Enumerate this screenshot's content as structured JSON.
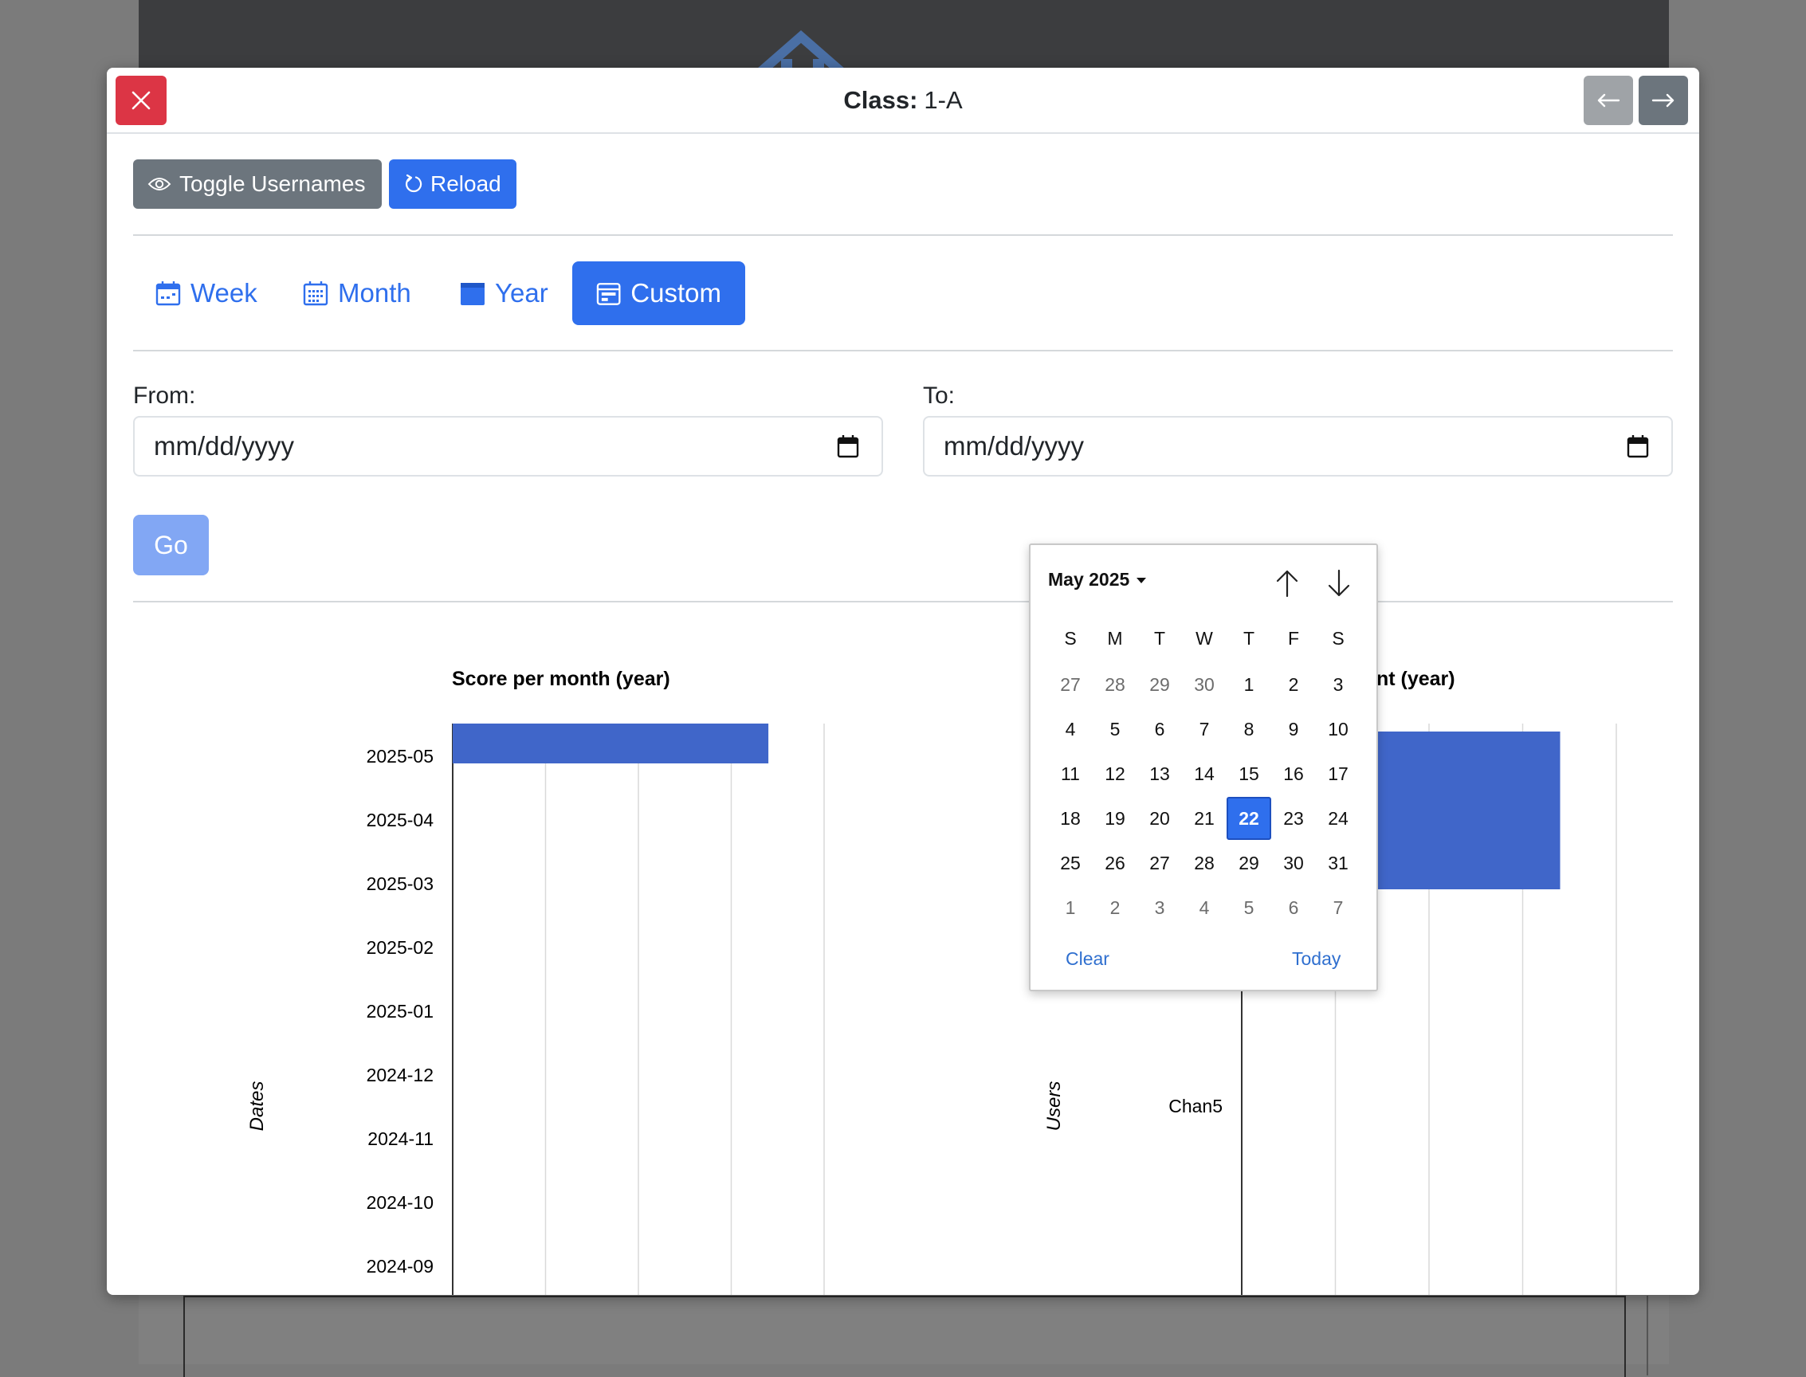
{
  "modal": {
    "title_label": "Class:",
    "title_value": "1-A"
  },
  "toolbar": {
    "toggle_usernames": "Toggle Usernames",
    "reload": "Reload"
  },
  "periods": {
    "week": "Week",
    "month": "Month",
    "year": "Year",
    "custom": "Custom",
    "active": "custom"
  },
  "form": {
    "from_label": "From:",
    "to_label": "To:",
    "from_value": "mm/dd/yyyy",
    "to_value": "mm/dd/yyyy",
    "go": "Go"
  },
  "datepicker": {
    "month_label": "May 2025",
    "weekdays": [
      "S",
      "M",
      "T",
      "W",
      "T",
      "F",
      "S"
    ],
    "weeks": [
      [
        "27",
        "28",
        "29",
        "30",
        "1",
        "2",
        "3"
      ],
      [
        "4",
        "5",
        "6",
        "7",
        "8",
        "9",
        "10"
      ],
      [
        "11",
        "12",
        "13",
        "14",
        "15",
        "16",
        "17"
      ],
      [
        "18",
        "19",
        "20",
        "21",
        "22",
        "23",
        "24"
      ],
      [
        "25",
        "26",
        "27",
        "28",
        "29",
        "30",
        "31"
      ],
      [
        "1",
        "2",
        "3",
        "4",
        "5",
        "6",
        "7"
      ]
    ],
    "selected_day": "22",
    "clear": "Clear",
    "today": "Today"
  },
  "chart_data": [
    {
      "type": "bar",
      "orientation": "horizontal",
      "title": "Score per month (year)",
      "ylabel": "Dates",
      "categories": [
        "2025-05",
        "2025-04",
        "2025-03",
        "2025-02",
        "2025-01",
        "2024-12",
        "2024-11",
        "2024-10",
        "2024-09"
      ],
      "values": [
        170,
        0,
        0,
        0,
        0,
        0,
        0,
        0,
        0
      ],
      "xlim": [
        0,
        200
      ],
      "grid": true
    },
    {
      "type": "bar",
      "orientation": "horizontal",
      "title": "Score per student (year)",
      "ylabel": "Users",
      "categories": [
        "Chan5"
      ],
      "values": [
        170
      ],
      "xlim": [
        0,
        200
      ],
      "grid": true
    }
  ],
  "colors": {
    "primary": "#2f6fed",
    "bar": "#4066c9",
    "danger": "#dc3545",
    "secondary": "#6c757d"
  }
}
